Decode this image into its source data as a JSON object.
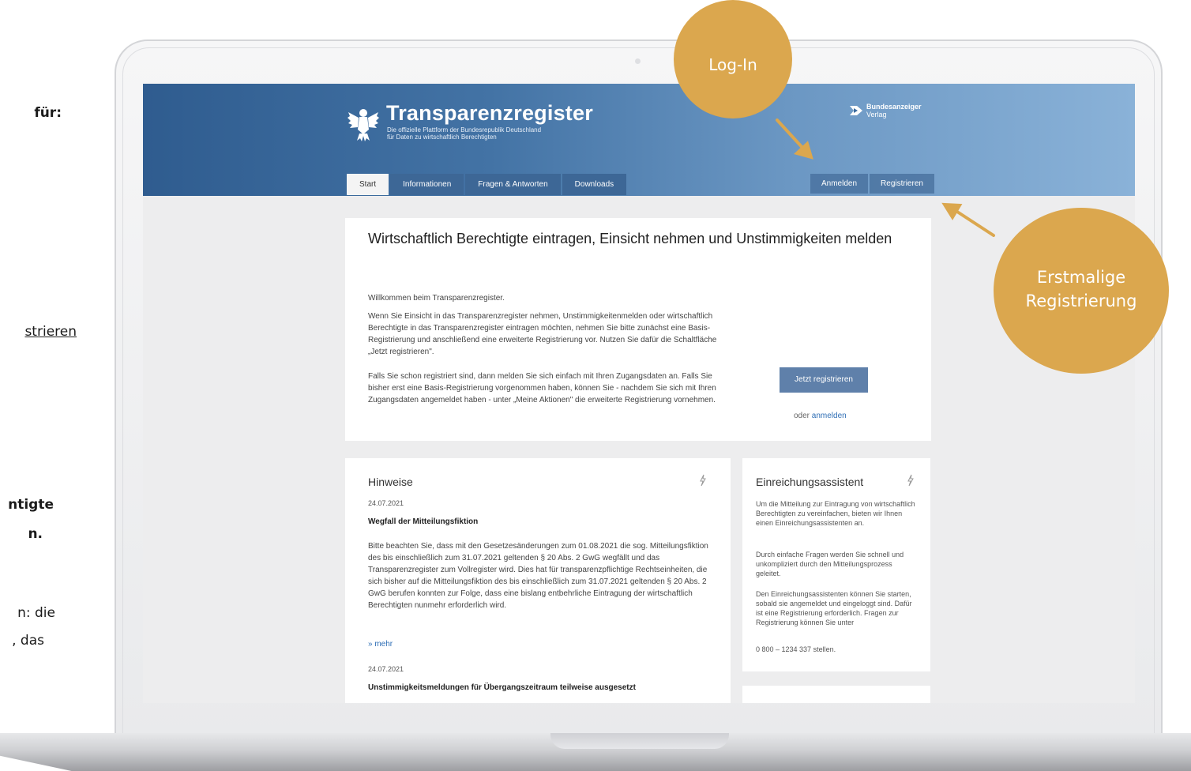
{
  "left_partial": {
    "fuer": "für:",
    "registrieren": "strieren",
    "line1": "ntigte",
    "line2": "n.",
    "line3": "n: die",
    "line4": ", das"
  },
  "header": {
    "title": "Transparenzregister",
    "subtitle_1": "Die offizielle Plattform der Bundesrepublik Deutschland",
    "subtitle_2": "für Daten zu wirtschaftlich Berechtigten",
    "publisher_name": "Bundesanzeiger",
    "publisher_sub": "Verlag"
  },
  "nav": {
    "tabs": [
      {
        "label": "Start"
      },
      {
        "label": "Informationen"
      },
      {
        "label": "Fragen & Antworten"
      },
      {
        "label": "Downloads"
      }
    ],
    "login_label": "Anmelden",
    "register_label": "Registrieren"
  },
  "main": {
    "heading": "Wirtschaftlich Berechtigte eintragen, Einsicht nehmen und Unstimmigkeiten melden",
    "welcome": "Willkommen beim Transparenzregister.",
    "body_1": "Wenn Sie Einsicht in das Transparenzregister nehmen, Unstimmigkeitenmelden oder wirtschaftlich Berechtigte in das Transparenzregister eintragen möchten, nehmen Sie bitte zunächst eine Basis-Registrierung und anschließend eine erweiterte Registrierung vor. Nutzen Sie dafür die Schaltfläche „Jetzt registrieren\".",
    "body_2": "Falls Sie schon registriert sind, dann melden Sie sich einfach mit Ihren Zugangsdaten an. Falls Sie bisher erst eine Basis-Registrierung vorgenommen haben, können Sie - nachdem Sie sich mit Ihren Zugangsdaten angemeldet haben - unter „Meine Aktionen\" die erweiterte Registrierung vornehmen.",
    "register_button": "Jetzt registrieren",
    "or_text": "oder ",
    "login_link": "anmelden"
  },
  "hints": {
    "title": "Hinweise",
    "items": [
      {
        "date": "24.07.2021",
        "title": "Wegfall der Mitteilungsfiktion",
        "text": "Bitte beachten Sie, dass mit den Gesetzesänderungen zum 01.08.2021 die sog. Mitteilungsfiktion des bis einschließlich zum 31.07.2021 geltenden § 20 Abs. 2 GwG wegfällt und das Transparenzregister zum Vollregister wird. Dies hat für transparenzpflichtige Rechtseinheiten, die sich bisher auf die Mitteilungsfiktion des bis einschließlich zum 31.07.2021 geltenden § 20 Abs. 2 GwG berufen konnten zur Folge, dass eine bislang entbehrliche Eintragung der wirtschaftlich Berechtigten nunmehr erforderlich wird.",
        "more": "» mehr"
      },
      {
        "date": "24.07.2021",
        "title": "Unstimmigkeitsmeldungen für Übergangszeitraum teilweise ausgesetzt"
      }
    ]
  },
  "assistant": {
    "title": "Einreichungsassistent",
    "p1": "Um die Mitteilung zur Eintragung von wirtschaftlich Berechtigten zu vereinfachen, bieten wir Ihnen einen Einreichungsassistenten an.",
    "p2": "Durch einfache Fragen werden Sie schnell und unkompliziert durch den Mitteilungsprozess geleitet.",
    "p3": "Den Einreichungsassistenten können Sie starten, sobald sie angemeldet und eingeloggt sind. Dafür ist eine Registrierung erforderlich. Fragen zur Registrierung können Sie unter",
    "phone": "0 800 – 1234 337 stellen."
  },
  "callouts": {
    "login": "Log-In",
    "first_1": "Erstmalige",
    "first_2": "Registrierung",
    "color": "#dba74e"
  },
  "colors": {
    "banner_start": "#2f5c8f",
    "banner_end": "#8ab2d8",
    "link": "#2e6eb5",
    "button": "#5f80aa"
  }
}
